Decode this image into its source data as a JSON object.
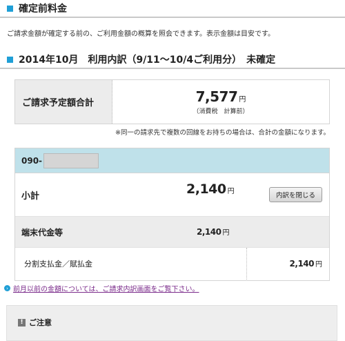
{
  "section1": {
    "title": "確定前料金"
  },
  "description": "ご請求金額が確定する前の、ご利用金額の概算を照会できます。表示金額は目安です。",
  "section2": {
    "title": "2014年10月　利用内訳（9/11〜10/4ご利用分）　未確定"
  },
  "total": {
    "label": "ご請求予定額合計",
    "amount": "7,577",
    "yen": "円",
    "sub": "（消費税　計算前）"
  },
  "note": "※同一の請求先で複数の回線をお持ちの場合は、合計の金額になります。",
  "line": {
    "number_prefix": "090-",
    "subtotal_label": "小計",
    "subtotal_amount": "2,140",
    "yen": "円",
    "close_button": "内訳を閉じる",
    "device_label": "端末代金等",
    "device_amount": "2,140",
    "installment_label": "分割支払金／賦払金",
    "installment_amount": "2,140"
  },
  "link": {
    "text": "前月以前の金額については、ご請求内訳画面をご覧下さい。"
  },
  "caution": {
    "title": "ご注意"
  },
  "colors": {
    "accent": "#1f9fd6",
    "header_bg": "#bfe1ea",
    "link": "#7a2a8a"
  }
}
